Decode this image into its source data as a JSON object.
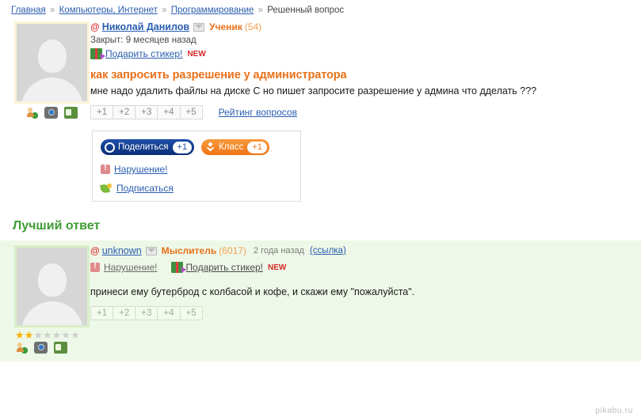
{
  "breadcrumb": {
    "items": [
      {
        "label": "Главная",
        "link": true
      },
      {
        "label": "Компьютеры, Интернет",
        "link": true
      },
      {
        "label": "Программирование",
        "link": true
      },
      {
        "label": "Решенный вопрос",
        "link": false
      }
    ],
    "separator": "»"
  },
  "question": {
    "author": "Николай Данилов",
    "at_symbol": "@",
    "rank": "Ученик",
    "rank_points": "(54)",
    "closed_status": "Закрыт: 9 месяцев назад",
    "gift_link": "Подарить стикер!",
    "new_badge": "NEW",
    "title": "как запросить разрешение у администратора",
    "body": "мне надо удалить файлы на диске С но пишет запросите разрешение у админа что дделать ???",
    "rating_buttons": [
      "+1",
      "+2",
      "+3",
      "+4",
      "+5"
    ],
    "rating_link": "Рейтинг вопросов",
    "share": {
      "share_label": "Поделиться",
      "share_count": "+1",
      "klass_label": "Класс",
      "klass_count": "+1",
      "violation_label": "Нарушение!",
      "subscribe_label": "Подписаться"
    },
    "icons": [
      "user-globe-icon",
      "camera-icon",
      "video-icon"
    ]
  },
  "best_answer": {
    "heading": "Лучший ответ",
    "author": "unknown",
    "at_symbol": "@",
    "rank": "Мыслитель",
    "rank_points": "(6017)",
    "time_ago": "2 года назад",
    "permalink": "(ссылка)",
    "violation_label": "Нарушение!",
    "gift_link": "Подарить стикер!",
    "new_badge": "NEW",
    "body": "принеси ему бутерброд с колбасой и кофе, и скажи ему \"пожалуйста\".",
    "rating_buttons": [
      "+1",
      "+2",
      "+3",
      "+4",
      "+5"
    ],
    "stars_total": 7,
    "stars_filled": 2,
    "icons": [
      "user-globe-icon",
      "camera-icon",
      "video-icon"
    ]
  },
  "watermark": "pikabu.ru",
  "colors": {
    "link": "#2a5db0",
    "rank_orange": "#e8711a",
    "best_answer_green": "#3f9c35",
    "answer_bg": "#eef8e8",
    "share_blue": "#0b3d91",
    "klass_orange": "#f58220"
  }
}
